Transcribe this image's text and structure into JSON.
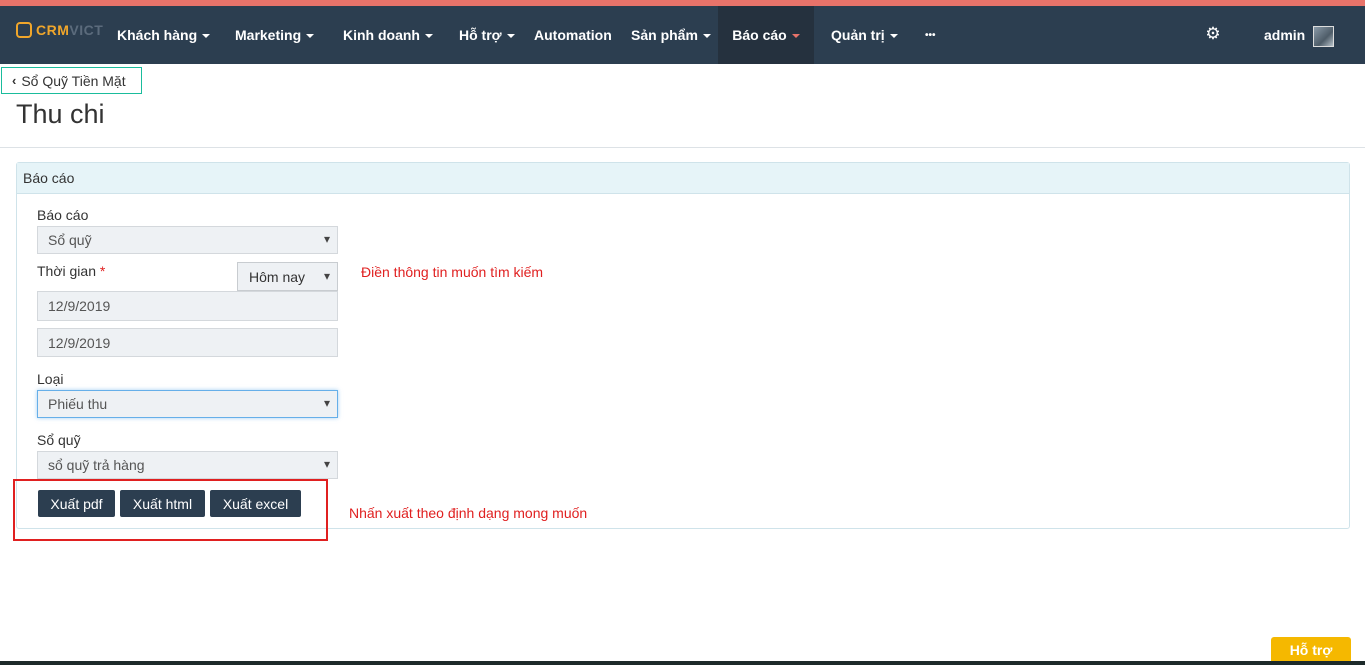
{
  "brand": {
    "part1": "CRM",
    "part2": "VICT"
  },
  "nav": {
    "items": [
      {
        "label": "Khách hàng"
      },
      {
        "label": "Marketing"
      },
      {
        "label": "Kinh doanh"
      },
      {
        "label": "Hỗ trợ"
      },
      {
        "label": "Automation"
      },
      {
        "label": "Sản phẩm"
      },
      {
        "label": "Báo cáo"
      },
      {
        "label": "Quản trị"
      },
      {
        "label": "•••"
      }
    ],
    "user": "admin"
  },
  "back_button": {
    "label": "Sổ Quỹ Tiền Mặt"
  },
  "page_title": "Thu chi",
  "panel": {
    "title": "Báo cáo",
    "report_label": "Báo cáo",
    "report_value": "Sổ quỹ",
    "time_label": "Thời gian",
    "time_required": "*",
    "time_range": "Hôm nay",
    "date_from": "12/9/2019",
    "date_to": "12/9/2019",
    "type_label": "Loại",
    "type_value": "Phiếu thu",
    "fund_label": "Sổ quỹ",
    "fund_value": "sổ quỹ trả hàng",
    "hint_search": "Điền thông tin muốn tìm kiếm",
    "hint_export": "Nhấn xuất theo định dạng mong muốn",
    "buttons": {
      "pdf": "Xuất pdf",
      "html": "Xuất html",
      "excel": "Xuất excel"
    }
  },
  "help_button": "Hỗ trợ",
  "colors": {
    "navbar": "#2c3e50",
    "accent": "#e8736a",
    "brand": "#f0a62b",
    "annotation": "#e02020",
    "help": "#f5b800"
  }
}
